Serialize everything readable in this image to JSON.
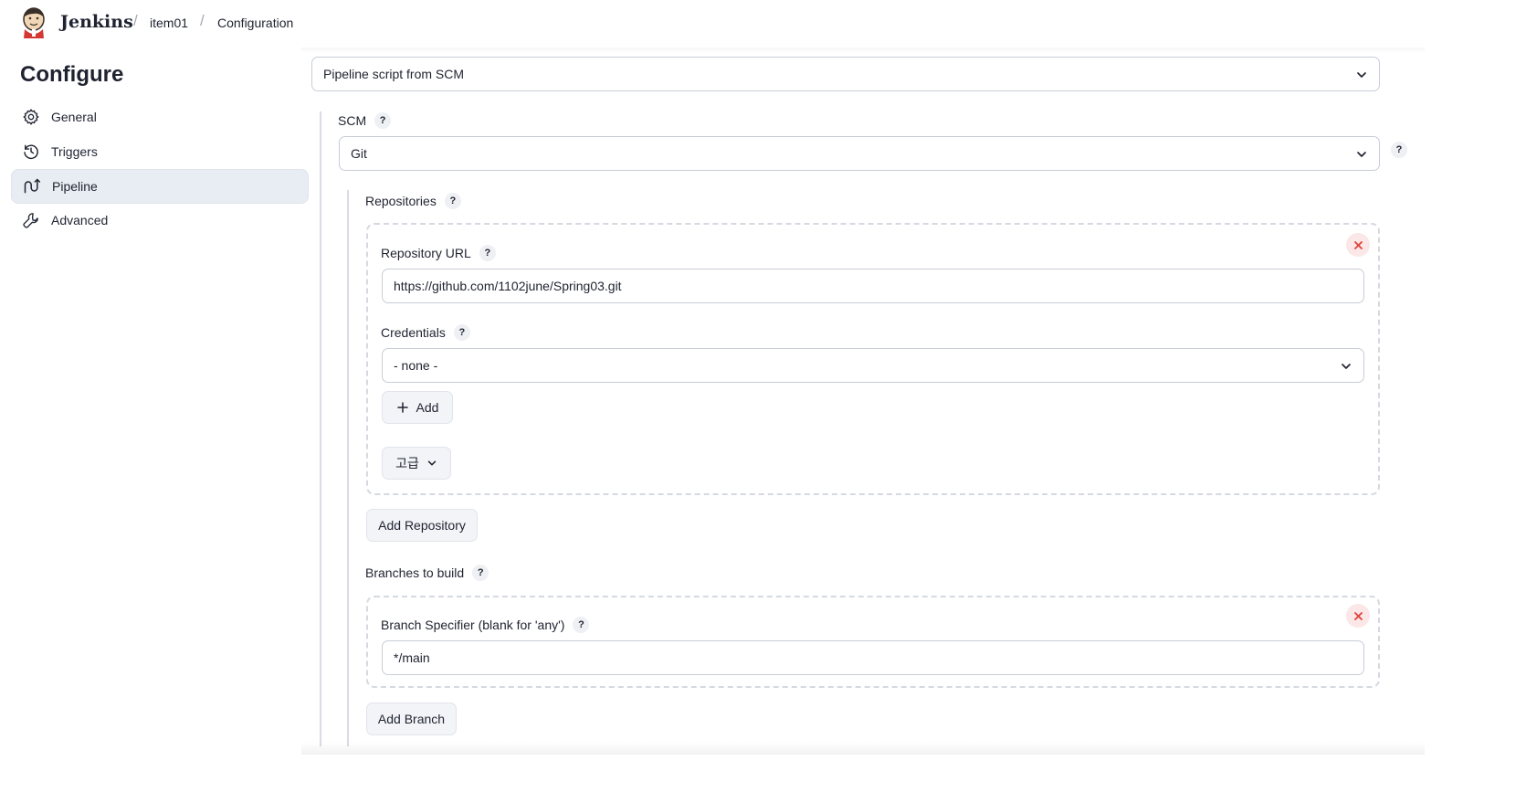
{
  "header": {
    "brand": "Jenkins",
    "breadcrumbs": [
      {
        "label": "item01"
      },
      {
        "label": "Configuration"
      }
    ],
    "separator": "/"
  },
  "sidebar": {
    "title": "Configure",
    "items": [
      {
        "label": "General",
        "icon": "gear-icon"
      },
      {
        "label": "Triggers",
        "icon": "clock-icon"
      },
      {
        "label": "Pipeline",
        "icon": "pipeline-icon",
        "active": true
      },
      {
        "label": "Advanced",
        "icon": "wrench-icon"
      }
    ]
  },
  "pipeline": {
    "definition_value": "Pipeline script from SCM",
    "scm_label": "SCM",
    "scm_value": "Git",
    "help_glyph": "?",
    "repositories_label": "Repositories",
    "repository": {
      "url_label": "Repository URL",
      "url_value": "https://github.com/1102june/Spring03.git",
      "credentials_label": "Credentials",
      "credentials_value": "- none -",
      "add_label": "Add",
      "advanced_label": "고급"
    },
    "add_repository_label": "Add Repository",
    "branches_label": "Branches to build",
    "branch": {
      "specifier_label": "Branch Specifier (blank for 'any')",
      "specifier_value": "*/main"
    },
    "add_branch_label": "Add Branch"
  },
  "colors": {
    "active_item_bg": "#e8ecf3",
    "close_bg": "#fbe7e7",
    "close_x": "#e0413c"
  }
}
